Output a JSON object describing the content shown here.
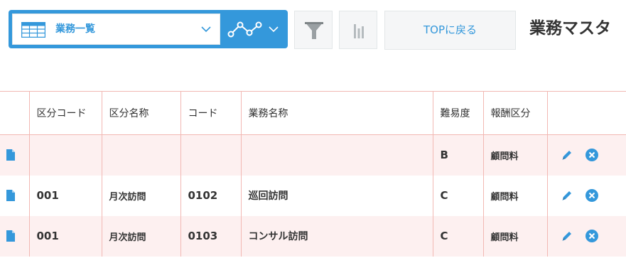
{
  "toolbar": {
    "view_select": {
      "label": "業務一覧",
      "icon": "table-icon"
    },
    "graph_select": {
      "icon": "line-graph-icon"
    },
    "filter_button_icon": "filter-icon",
    "chart_button_icon": "bar-chart-icon",
    "top_button_label": "TOPに戻る",
    "app_title": "業務マスタ"
  },
  "colors": {
    "accent": "#3498db",
    "row_alt": "#fdf0f0",
    "grid_line": "#f2b8b3"
  },
  "table": {
    "columns": [
      "",
      "区分コード",
      "区分名称",
      "コード",
      "業務名称",
      "難易度",
      "報酬区分",
      ""
    ],
    "rows": [
      {
        "category_code": "",
        "category_name": "",
        "code": "",
        "task_name": "",
        "difficulty": "B",
        "fee_type": "顧問料"
      },
      {
        "category_code": "001",
        "category_name": "月次訪問",
        "code": "0102",
        "task_name": "巡回訪問",
        "difficulty": "C",
        "fee_type": "顧問料"
      },
      {
        "category_code": "001",
        "category_name": "月次訪問",
        "code": "0103",
        "task_name": "コンサル訪問",
        "difficulty": "C",
        "fee_type": "顧問料"
      }
    ],
    "row_icons": {
      "detail": "document-icon",
      "edit": "pencil-icon",
      "delete": "remove-icon"
    }
  }
}
